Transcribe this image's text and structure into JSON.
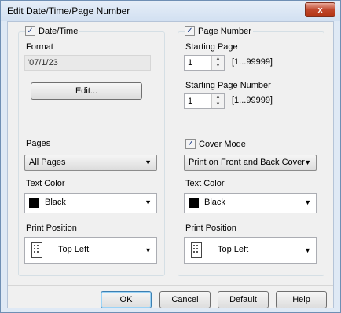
{
  "window": {
    "title": "Edit Date/Time/Page Number",
    "close_icon": "close-icon"
  },
  "left": {
    "datetime_label": "Date/Time",
    "datetime_checked": true,
    "format_label": "Format",
    "format_value": "'07/1/23",
    "edit_label": "Edit...",
    "pages_label": "Pages",
    "pages_value": "All Pages",
    "text_color_label": "Text Color",
    "text_color_value": "Black",
    "text_color_hex": "#000000",
    "print_position_label": "Print Position",
    "print_position_value": "Top Left"
  },
  "right": {
    "page_number_label": "Page Number",
    "page_number_checked": true,
    "starting_page_label": "Starting Page",
    "starting_page_value": "1",
    "starting_page_range": "[1...99999]",
    "starting_page_number_label": "Starting Page Number",
    "starting_page_number_value": "1",
    "starting_page_number_range": "[1...99999]",
    "cover_mode_label": "Cover Mode",
    "cover_mode_checked": true,
    "cover_mode_value": "Print on Front and Back Cover",
    "text_color_label": "Text Color",
    "text_color_value": "Black",
    "text_color_hex": "#000000",
    "print_position_label": "Print Position",
    "print_position_value": "Top Left"
  },
  "buttons": {
    "ok": "OK",
    "cancel": "Cancel",
    "default": "Default",
    "help": "Help"
  },
  "glyphs": {
    "check": "✓",
    "down": "▼",
    "up": "▲",
    "close": "x"
  }
}
